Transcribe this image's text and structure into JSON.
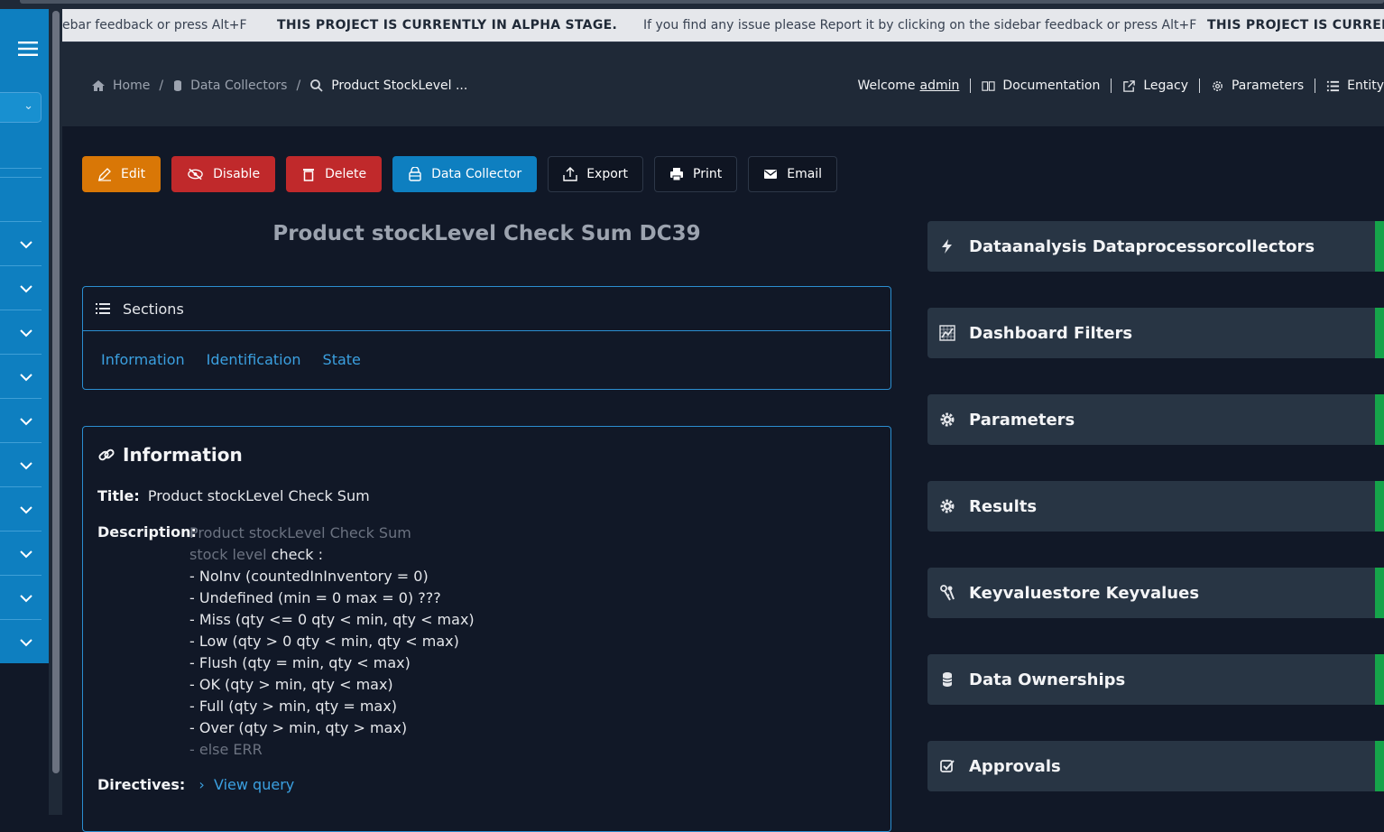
{
  "ticker": {
    "left": "ebar feedback or press Alt+F",
    "alpha": "THIS PROJECT IS CURRENTLY IN ALPHA STAGE.",
    "msg": "If you find any issue please Report it by clicking on the sidebar feedback or press Alt+F",
    "alpha_cut": "THIS PROJECT IS CURREN"
  },
  "breadcrumb": {
    "home": "Home",
    "collectors": "Data Collectors",
    "current": "Product StockLevel ..."
  },
  "topnav": {
    "welcome": "Welcome",
    "user": "admin",
    "documentation": "Documentation",
    "legacy": "Legacy",
    "parameters": "Parameters",
    "entity": "Entity"
  },
  "toolbar": {
    "edit": "Edit",
    "disable": "Disable",
    "delete": "Delete",
    "data_collector": "Data Collector",
    "export": "Export",
    "print": "Print",
    "email": "Email"
  },
  "page": {
    "title": "Product stockLevel Check Sum DC39"
  },
  "sections": {
    "header": "Sections",
    "links": [
      "Information",
      "Identification",
      "State"
    ]
  },
  "info": {
    "header": "Information",
    "title_label": "Title:",
    "title_value": "Product stockLevel Check Sum",
    "desc_label": "Description:",
    "desc_line1": "Product stockLevel Check Sum",
    "desc_line2a": "stock level",
    "desc_line2b": " check :",
    "desc_items": [
      "- NoInv (countedInInventory = 0)",
      "- Undefined (min = 0 max = 0) ???",
      "- Miss (qty <= 0 qty < min, qty < max)",
      "- Low (qty > 0 qty < min, qty < max)",
      "- Flush (qty = min, qty < max)",
      "- OK (qty > min, qty < max)",
      "- Full (qty > min, qty = max)",
      "- Over (qty > min, qty > max)"
    ],
    "desc_last": "- else ERR",
    "directives_label": "Directives:",
    "view_query": "View query"
  },
  "panels": [
    {
      "label": "Dataanalysis Dataprocessorcollectors",
      "icon": "bolt-icon"
    },
    {
      "label": "Dashboard Filters",
      "icon": "chart-icon"
    },
    {
      "label": "Parameters",
      "icon": "gear-icon"
    },
    {
      "label": "Results",
      "icon": "gear-icon"
    },
    {
      "label": "Keyvaluestore Keyvalues",
      "icon": "keys-icon"
    },
    {
      "label": "Data Ownerships",
      "icon": "database-icon"
    },
    {
      "label": "Approvals",
      "icon": "check-square-icon"
    }
  ],
  "colors": {
    "accent": "#0e7fc0",
    "edit": "#d97706",
    "danger": "#c0292b",
    "success": "#16a34a"
  }
}
